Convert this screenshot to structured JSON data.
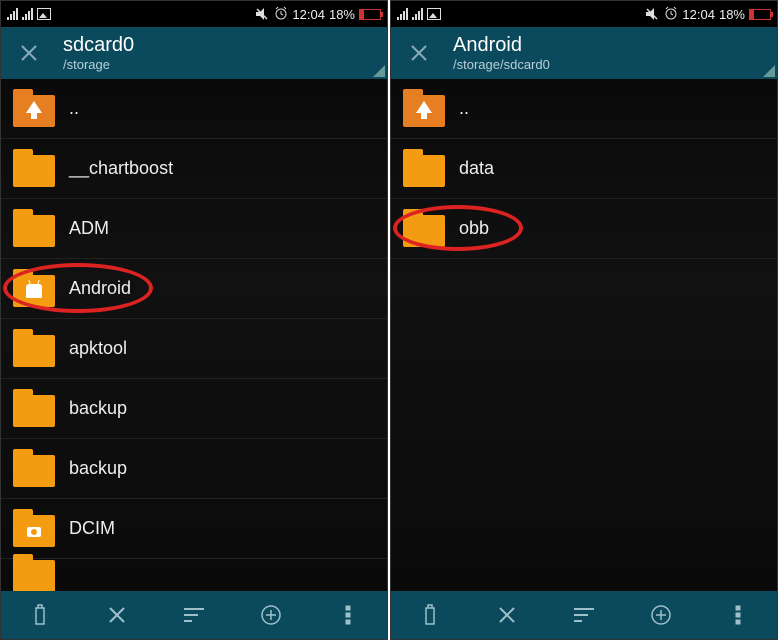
{
  "status": {
    "time": "12:04",
    "battery_percent": "18%"
  },
  "screens": [
    {
      "header": {
        "title": "sdcard0",
        "path": "/storage"
      },
      "circle_target": "Android",
      "items": [
        {
          "name": "..",
          "type": "up"
        },
        {
          "name": "__chartboost",
          "type": "folder"
        },
        {
          "name": "ADM",
          "type": "folder"
        },
        {
          "name": "Android",
          "type": "android"
        },
        {
          "name": "apktool",
          "type": "folder"
        },
        {
          "name": "backup",
          "type": "folder"
        },
        {
          "name": "backup",
          "type": "folder"
        },
        {
          "name": "DCIM",
          "type": "camera"
        }
      ]
    },
    {
      "header": {
        "title": "Android",
        "path": "/storage/sdcard0"
      },
      "circle_target": "obb",
      "items": [
        {
          "name": "..",
          "type": "up"
        },
        {
          "name": "data",
          "type": "folder"
        },
        {
          "name": "obb",
          "type": "folder"
        }
      ]
    }
  ]
}
